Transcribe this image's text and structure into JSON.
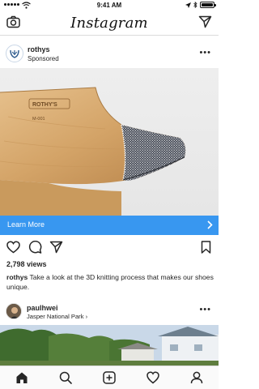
{
  "status_bar": {
    "time": "9:41 AM"
  },
  "nav": {
    "logo": "Instagram"
  },
  "post": {
    "username": "rothys",
    "sponsored": "Sponsored",
    "more": "•••",
    "image_text_brand": "ROTHY'S",
    "image_text_code": "M-001",
    "cta": "Learn More",
    "views": "2,798 views",
    "caption_user": "rothys",
    "caption_text": "Take a look at the 3D knitting process that makes our shoes unique."
  },
  "post2": {
    "username": "paulhwei",
    "location": "Jasper National Park",
    "location_chevron": "›",
    "more": "•••"
  },
  "colors": {
    "accent": "#3897f0",
    "text": "#262626",
    "divider": "#dbdbdb"
  },
  "icons": {
    "nav": [
      "camera-icon",
      "direct-message-icon"
    ],
    "actions": [
      "heart-icon",
      "comment-icon",
      "share-icon",
      "bookmark-icon"
    ],
    "tabs": [
      "home-icon",
      "search-icon",
      "add-icon",
      "activity-icon",
      "profile-icon"
    ]
  }
}
